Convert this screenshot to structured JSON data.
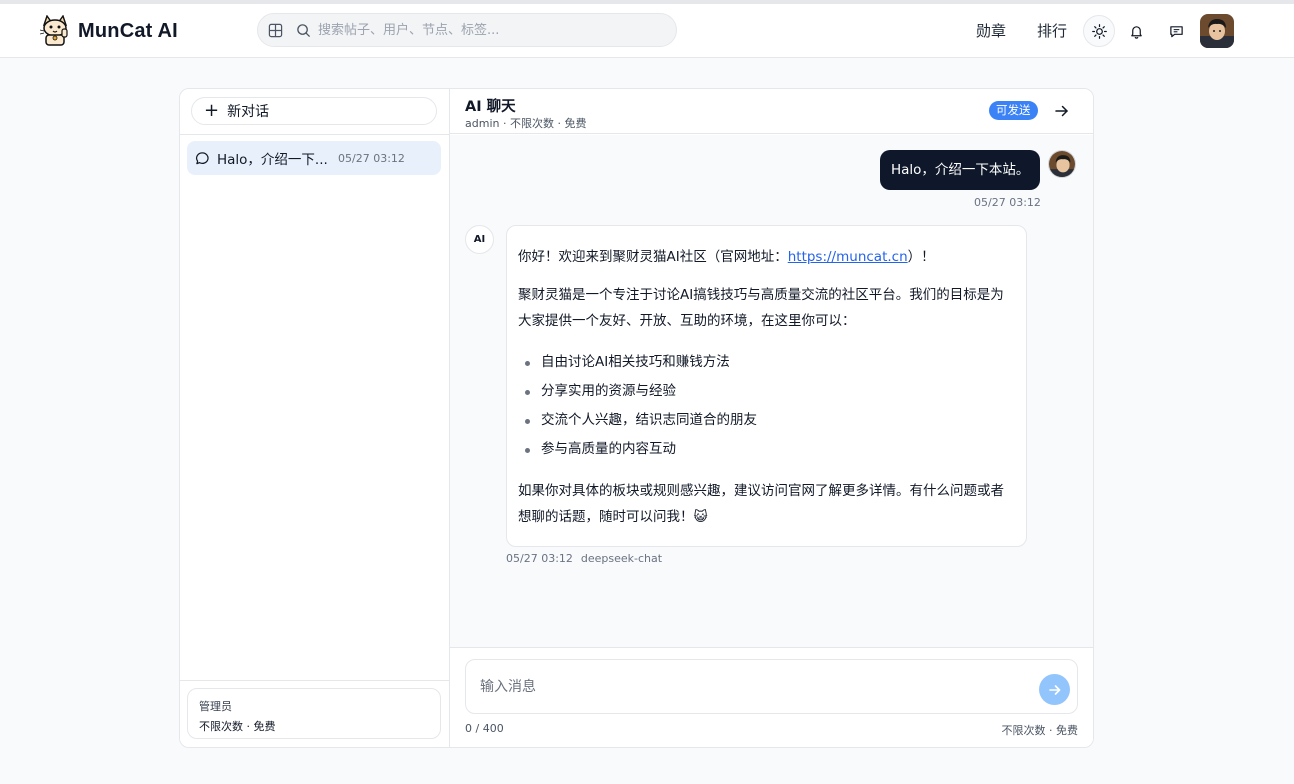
{
  "app": {
    "name": "MunCat AI"
  },
  "search": {
    "placeholder": "搜索帖子、用户、节点、标签..."
  },
  "nav": {
    "medal": "勋章",
    "rank": "排行"
  },
  "sidebar": {
    "new_chat": "新对话",
    "conversations": [
      {
        "title": "Halo，介绍一下...",
        "time": "05/27 03:12",
        "active": true
      }
    ],
    "footer": {
      "role": "管理员",
      "quota": "不限次数 · 免费"
    }
  },
  "chat": {
    "title": "AI 聊天",
    "subtitle": "admin · 不限次数 · 免费",
    "status_badge": "可发送",
    "user_message": {
      "text": "Halo，介绍一下本站。",
      "time": "05/27 03:12"
    },
    "ai_avatar_label": "AI",
    "ai_message": {
      "intro_prefix": "你好！欢迎来到聚财灵猫AI社区（官网地址：",
      "link": "https://muncat.cn",
      "intro_suffix": "）！",
      "para2": "聚财灵猫是一个专注于讨论AI搞钱技巧与高质量交流的社区平台。我们的目标是为大家提供一个友好、开放、互助的环境，在这里你可以：",
      "bullets": [
        "自由讨论AI相关技巧和赚钱方法",
        "分享实用的资源与经验",
        "交流个人兴趣，结识志同道合的朋友",
        "参与高质量的内容互动"
      ],
      "para3": "如果你对具体的板块或规则感兴趣，建议访问官网了解更多详情。有什么问题或者想聊的话题，随时可以问我！😺",
      "time": "05/27 03:12",
      "model": "deepseek-chat"
    },
    "composer": {
      "placeholder": "输入消息",
      "counter": "0 / 400",
      "quota": "不限次数 · 免费"
    }
  },
  "colors": {
    "accent": "#3b82f6",
    "user_bubble": "#0f172a",
    "active_conversation": "#e8f1fb",
    "send_button": "#93c5fd"
  }
}
